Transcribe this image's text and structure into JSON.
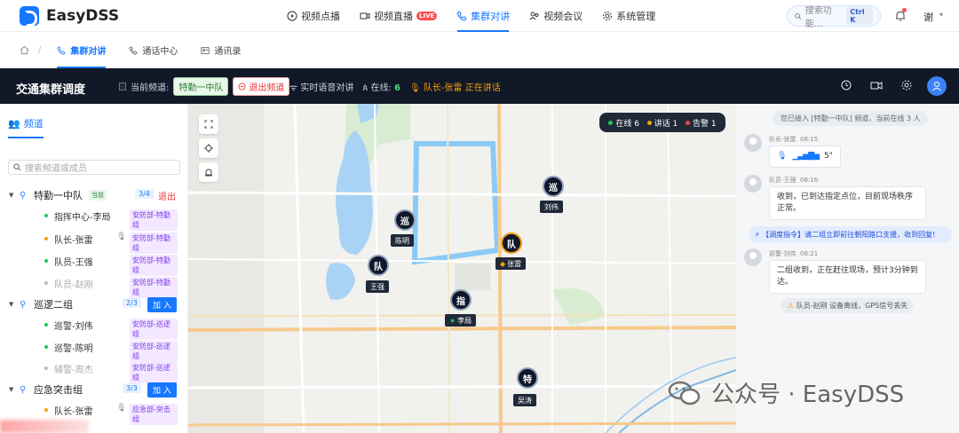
{
  "app": {
    "name": "EasyDSS"
  },
  "nav": {
    "items": [
      {
        "label": "视频点播",
        "icon": "play-circle-icon"
      },
      {
        "label": "视频直播",
        "icon": "video-camera-icon",
        "badge": "LIVE"
      },
      {
        "label": "集群对讲",
        "icon": "phone-icon"
      },
      {
        "label": "视频会议",
        "icon": "people-icon"
      },
      {
        "label": "系统管理",
        "icon": "gear-icon"
      }
    ],
    "active_index": 2,
    "search_placeholder": "搜索功能...",
    "search_shortcut": "Ctrl K",
    "user": "谢"
  },
  "breadcrumb": {
    "items": [
      "集群对讲",
      "通话中心",
      "通讯录"
    ]
  },
  "dispatch": {
    "title": "交通集群调度",
    "current_channel_label": "当前频道:",
    "current_channel": "特勤一中队",
    "exit_label": "退出频道",
    "realtime_label": "实时语音对讲",
    "online_label": "在线:",
    "online_count": "6",
    "speaking": "队长-张雷 正在讲话"
  },
  "sidebar": {
    "tab": "频道",
    "search_placeholder": "搜索频道或成员",
    "groups": [
      {
        "name": "特勤一中队",
        "now": "当前",
        "count": "3/4",
        "action": "退出",
        "members": [
          {
            "name": "指挥中心-李局",
            "tag": "安防部-特勤组",
            "status": "online",
            "mic": false
          },
          {
            "name": "队长-张雷",
            "tag": "安防部-特勤组",
            "status": "speaking",
            "mic": true
          },
          {
            "name": "队员-王强",
            "tag": "安防部-特勤组",
            "status": "online",
            "mic": false
          },
          {
            "name": "队员-赵刚",
            "tag": "安防部-特勤组",
            "status": "offline",
            "mic": false
          }
        ]
      },
      {
        "name": "巡逻二组",
        "count": "2/3",
        "action": "加 入",
        "members": [
          {
            "name": "巡警-刘伟",
            "tag": "安防部-巡逻组",
            "status": "online",
            "mic": false
          },
          {
            "name": "巡警-陈明",
            "tag": "安防部-巡逻组",
            "status": "online",
            "mic": false
          },
          {
            "name": "辅警-周杰",
            "tag": "安防部-巡逻组",
            "status": "offline",
            "mic": false
          }
        ]
      },
      {
        "name": "应急突击组",
        "count": "3/3",
        "action": "加 入",
        "members": [
          {
            "name": "队长-张雷",
            "tag": "应急部-突击组",
            "status": "speaking",
            "mic": true
          }
        ]
      }
    ]
  },
  "map": {
    "status": {
      "online": "在线 6",
      "talking": "讲话 1",
      "alarm": "告警 1"
    },
    "markers": [
      {
        "char": "巡",
        "label": "刘伟",
        "speaking": false
      },
      {
        "char": "巡",
        "label": "陈明",
        "speaking": false
      },
      {
        "char": "队",
        "label": "张雷",
        "speaking": true
      },
      {
        "char": "队",
        "label": "王强",
        "speaking": false
      },
      {
        "char": "指",
        "label": "李局",
        "speaking": false
      },
      {
        "char": "特",
        "label": "吴涛",
        "speaking": false
      }
    ]
  },
  "chat": {
    "system": "您已接入 [特勤一中队] 频道，当前在线 3 人",
    "messages": [
      {
        "sender": "队长-张雷",
        "time": "08:15",
        "voice": "5\""
      },
      {
        "sender": "队员-王强",
        "time": "08:16",
        "text": "收到，已到达指定点位，目前现场秩序正常。"
      },
      {
        "sender": "巡警-刘伟",
        "time": "08:21",
        "text": "二组收到，正在赶往现场，预计3分钟到达。"
      }
    ],
    "command": "【调度指令】请二组立即前往朝阳路口支援，收到回复!",
    "warning": "队员-赵刚 设备离线，GPS信号丢失"
  },
  "watermark": "公众号 · EasyDSS",
  "colors": {
    "accent": "#1677ff",
    "dark": "#111827",
    "online": "#22c55e",
    "speaking": "#f59e0b",
    "alarm": "#ef4444"
  }
}
